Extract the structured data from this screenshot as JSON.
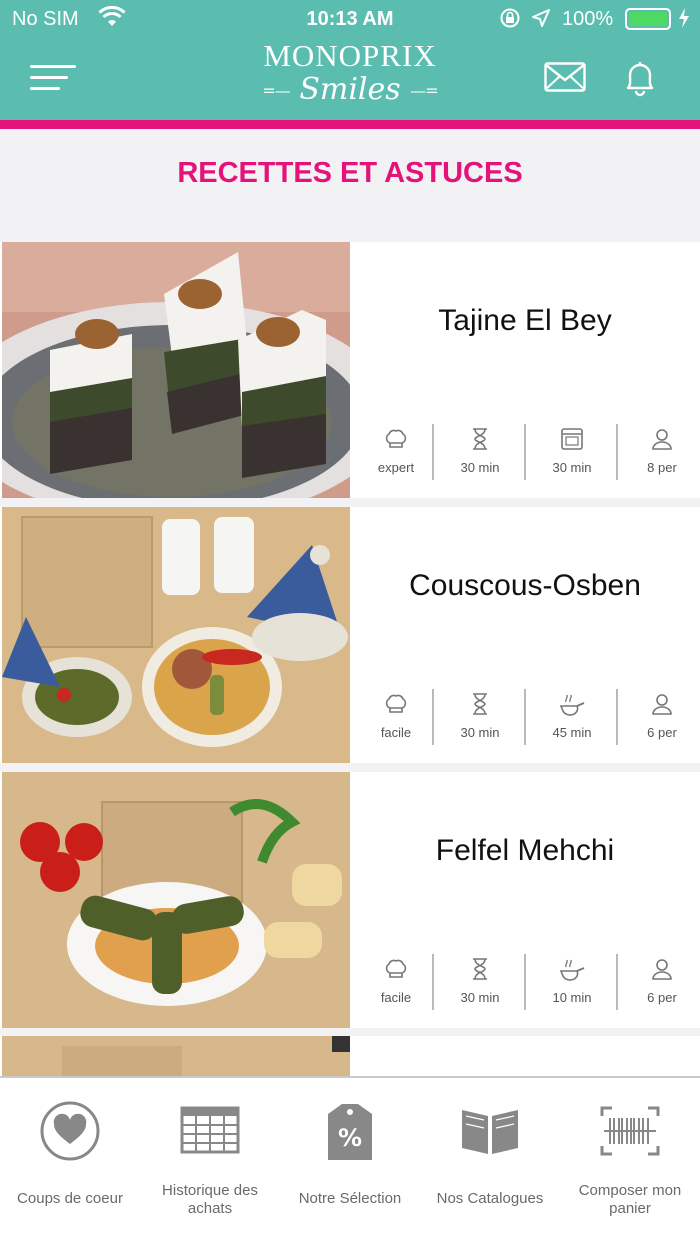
{
  "status_bar": {
    "carrier": "No SIM",
    "time": "10:13 AM",
    "battery": "100%"
  },
  "header": {
    "brand": "MONOPRIX",
    "sub": "Smiles"
  },
  "page_title": "RECETTES ET ASTUCES",
  "recipes": [
    {
      "name": "Tajine El Bey",
      "stats": [
        {
          "icon": "chef-hat-icon",
          "label": "expert"
        },
        {
          "icon": "hourglass-icon",
          "label": "30 min"
        },
        {
          "icon": "oven-icon",
          "label": "30 min"
        },
        {
          "icon": "person-icon",
          "label": "8 per"
        }
      ]
    },
    {
      "name": "Couscous-Osben",
      "stats": [
        {
          "icon": "chef-hat-icon",
          "label": "facile"
        },
        {
          "icon": "hourglass-icon",
          "label": "30 min"
        },
        {
          "icon": "frying-pan-icon",
          "label": "45 min"
        },
        {
          "icon": "person-icon",
          "label": "6 per"
        }
      ]
    },
    {
      "name": "Felfel Mehchi",
      "stats": [
        {
          "icon": "chef-hat-icon",
          "label": "facile"
        },
        {
          "icon": "hourglass-icon",
          "label": "30 min"
        },
        {
          "icon": "frying-pan-icon",
          "label": "10 min"
        },
        {
          "icon": "person-icon",
          "label": "6 per"
        }
      ]
    }
  ],
  "tabbar": [
    {
      "label": "Coups de coeur",
      "icon": "heart-icon"
    },
    {
      "label": "Historique des achats",
      "icon": "calendar-grid-icon"
    },
    {
      "label": "Notre Sélection",
      "icon": "discount-tag-icon"
    },
    {
      "label": "Nos Catalogues",
      "icon": "open-book-icon"
    },
    {
      "label": "Composer mon panier",
      "icon": "barcode-scan-icon"
    }
  ],
  "colors": {
    "header": "#5bbdb0",
    "accent": "#e4127a",
    "battery": "#4cd964"
  }
}
